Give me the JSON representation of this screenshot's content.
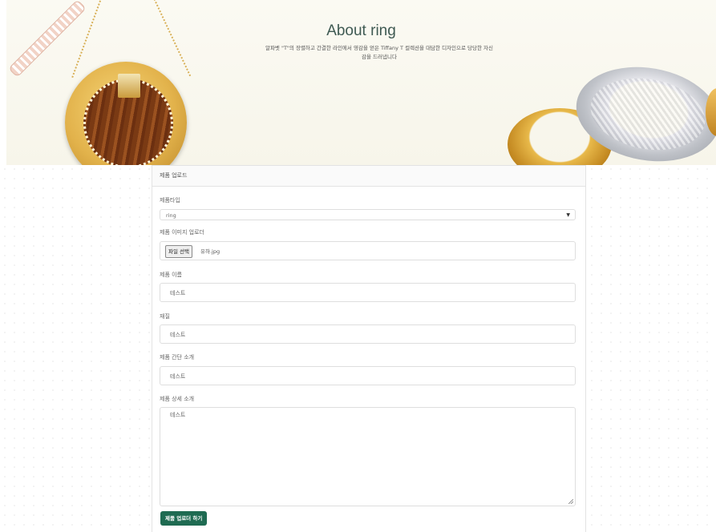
{
  "hero": {
    "title": "About ring",
    "subtitle": "알파벳 \"T\"의 장렬하고 간결한 라인에서 영감을 얻은 Tiffany T 컬렉션을 대담한 디자인으로 당당한 자신감을 드러냅니다"
  },
  "form": {
    "card_title": "제품 업로드",
    "type_label": "제품타입",
    "type_value": "ring",
    "image_label": "제품 이미지 업로더",
    "file_button": "파일 선택",
    "file_name": "유하.jpg",
    "name_label": "제품 이름",
    "name_value": "테스트",
    "material_label": "재질",
    "material_value": "테스트",
    "short_desc_label": "제품 간단 소개",
    "short_desc_value": "테스트",
    "detail_desc_label": "제품 상세 소개",
    "detail_desc_value": "테스트",
    "submit_label": "제품 업로더 하기"
  },
  "colors": {
    "accent": "#1f6b52",
    "title": "#3f5a53",
    "hero_bg": "#fbfaf3"
  }
}
